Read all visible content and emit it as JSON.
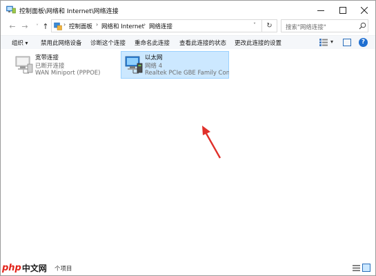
{
  "window": {
    "title": "控制面板\\网络和 Internet\\网络连接",
    "controls": {
      "minimize": "minimize-icon",
      "maximize": "maximize-icon",
      "close": "close-icon"
    }
  },
  "address": {
    "breadcrumbs": [
      "控制面板",
      "网络和 Internet",
      "网络连接"
    ],
    "search_placeholder": "搜索\"网络连接\""
  },
  "toolbar": {
    "organize": "组织",
    "disable": "禁用此网络设备",
    "diagnose": "诊断这个连接",
    "rename": "重命名此连接",
    "view_status": "查看此连接的状态",
    "change_settings": "更改此连接的设置"
  },
  "connections": [
    {
      "name": "宽带连接",
      "status": "已断开连接",
      "device": "WAN Miniport (PPPOE)",
      "icon": "broadband-connection-icon",
      "selected": false
    },
    {
      "name": "以太网",
      "status": "网络 4",
      "device": "Realtek PCIe GBE Family Contr...",
      "icon": "ethernet-connection-icon",
      "selected": true
    }
  ],
  "statusbar": {
    "count": "个项目"
  },
  "watermark": {
    "brand": "php",
    "suffix": "中文网"
  },
  "colors": {
    "selection_bg": "#cce8ff",
    "selection_border": "#99d1ff",
    "arrow": "#e0302a",
    "accent": "#1f6fd1"
  }
}
